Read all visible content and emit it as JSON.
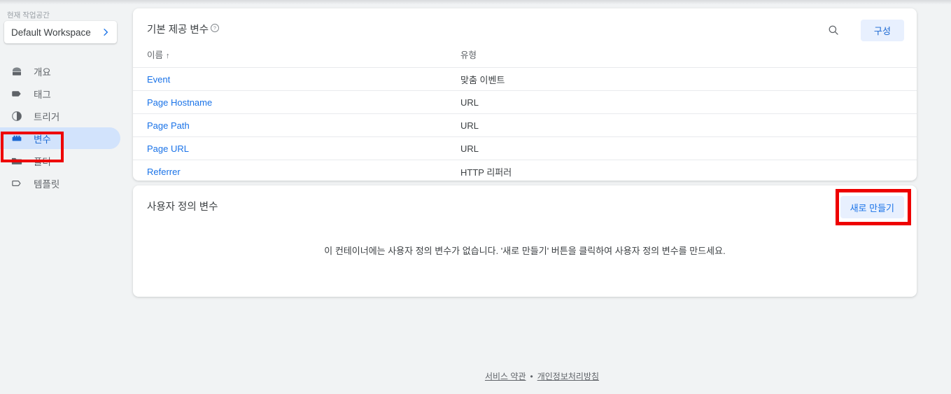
{
  "sidebar": {
    "workspace_label": "현재 작업공간",
    "workspace_name": "Default Workspace",
    "chevron_icon": "chevron-right-icon",
    "items": [
      {
        "label": "개요",
        "icon": "overview-icon",
        "active": false
      },
      {
        "label": "태그",
        "icon": "tag-icon",
        "active": false
      },
      {
        "label": "트리거",
        "icon": "trigger-icon",
        "active": false
      },
      {
        "label": "변수",
        "icon": "variable-icon",
        "active": true
      },
      {
        "label": "폴더",
        "icon": "folder-icon",
        "active": false
      },
      {
        "label": "템플릿",
        "icon": "template-icon",
        "active": false
      }
    ]
  },
  "builtin_card": {
    "title": "기본 제공 변수",
    "help_icon": "help-circle-icon",
    "search_icon": "search-icon",
    "configure_label": "구성",
    "columns": {
      "name": "이름",
      "type": "유형"
    },
    "sort_arrow": "↑",
    "rows": [
      {
        "name": "Event",
        "type": "맞춤 이벤트"
      },
      {
        "name": "Page Hostname",
        "type": "URL"
      },
      {
        "name": "Page Path",
        "type": "URL"
      },
      {
        "name": "Page URL",
        "type": "URL"
      },
      {
        "name": "Referrer",
        "type": "HTTP 리퍼러"
      }
    ]
  },
  "user_card": {
    "title": "사용자 정의 변수",
    "create_label": "새로 만들기",
    "empty_message": "이 컨테이너에는 사용자 정의 변수가 없습니다. '새로 만들기' 버튼을 클릭하여 사용자 정의 변수를 만드세요."
  },
  "footer": {
    "terms": "서비스 약관",
    "separator": "•",
    "privacy": "개인정보처리방침"
  },
  "annotations": {
    "highlight_color": "#ee0000",
    "targets": [
      "sidebar-item-variables",
      "create-new-variable-button"
    ]
  },
  "colors": {
    "page_background": "#f1f3f4",
    "card_background": "#ffffff",
    "accent_blue": "#1a73e8",
    "active_pill": "#d2e3fc",
    "button_fill": "#e8f0fe"
  }
}
